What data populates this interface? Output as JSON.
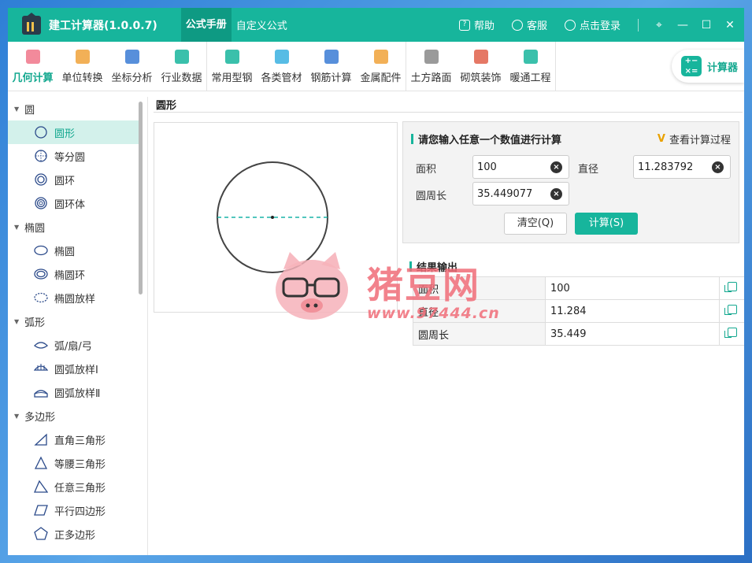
{
  "titlebar": {
    "app_title": "建工计算器(1.0.0.7)",
    "tab_main": "公式手册",
    "tab_custom": "自定义公式",
    "help": "帮助",
    "service": "客服",
    "login": "点击登录",
    "pin": "⌖",
    "minimize": "—",
    "maximize": "☐",
    "close": "✕"
  },
  "toolbar": {
    "groups": [
      [
        {
          "label": "几何计算",
          "icon": "cube-icon",
          "color": "#f0768a",
          "active": true
        },
        {
          "label": "单位转换",
          "icon": "ruler-cm-icon",
          "color": "#f0a23a"
        },
        {
          "label": "坐标分析",
          "icon": "axis-icon",
          "color": "#3a7bd5"
        },
        {
          "label": "行业数据",
          "icon": "bar-chart-icon",
          "color": "#17b59c"
        }
      ],
      [
        {
          "label": "常用型钢",
          "icon": "wrench-icon",
          "color": "#17b59c"
        },
        {
          "label": "各类管材",
          "icon": "pipe-icon",
          "color": "#3ab0e0"
        },
        {
          "label": "钢筋计算",
          "icon": "rebar-icon",
          "color": "#3a7bd5"
        },
        {
          "label": "金属配件",
          "icon": "hammer-icon",
          "color": "#f0a23a"
        }
      ],
      [
        {
          "label": "土方路面",
          "icon": "road-icon",
          "color": "#888888"
        },
        {
          "label": "砌筑装饰",
          "icon": "brick-icon",
          "color": "#e0604a"
        },
        {
          "label": "暖通工程",
          "icon": "fan-icon",
          "color": "#17b59c"
        }
      ]
    ],
    "calc_button": "计算器",
    "calc_icon_glyph": "+−\n×="
  },
  "sidebar": {
    "groups": [
      {
        "title": "圆",
        "items": [
          {
            "label": "圆形",
            "icon": "circle-icon",
            "selected": true
          },
          {
            "label": "等分圆",
            "icon": "divided-circle-icon"
          },
          {
            "label": "圆环",
            "icon": "ring-icon"
          },
          {
            "label": "圆环体",
            "icon": "torus-icon"
          }
        ]
      },
      {
        "title": "椭圆",
        "items": [
          {
            "label": "椭圆",
            "icon": "ellipse-icon"
          },
          {
            "label": "椭圆环",
            "icon": "ellipse-ring-icon"
          },
          {
            "label": "椭圆放样",
            "icon": "ellipse-loft-icon"
          }
        ]
      },
      {
        "title": "弧形",
        "items": [
          {
            "label": "弧/扇/弓",
            "icon": "arc-icon"
          },
          {
            "label": "圆弧放样Ⅰ",
            "icon": "arc-loft-1-icon"
          },
          {
            "label": "圆弧放样Ⅱ",
            "icon": "arc-loft-2-icon"
          }
        ]
      },
      {
        "title": "多边形",
        "items": [
          {
            "label": "直角三角形",
            "icon": "right-triangle-icon"
          },
          {
            "label": "等腰三角形",
            "icon": "isosceles-triangle-icon"
          },
          {
            "label": "任意三角形",
            "icon": "triangle-icon"
          },
          {
            "label": "平行四边形",
            "icon": "parallelogram-icon"
          },
          {
            "label": "正多边形",
            "icon": "pentagon-icon"
          }
        ]
      }
    ]
  },
  "main": {
    "title": "圆形",
    "input_panel": {
      "title": "请您输入任意一个数值进行计算",
      "view_process": "查看计算过程",
      "view_process_glyph": "V",
      "area_label": "面积",
      "area_value": "100",
      "diameter_label": "直径",
      "diameter_value": "11.283792",
      "circumference_label": "圆周长",
      "circumference_value": "35.449077",
      "clear_button": "清空(Q)",
      "calc_button": "计算(S)"
    },
    "result": {
      "title": "结果输出",
      "rows": [
        {
          "key": "面积",
          "value": "100"
        },
        {
          "key": "直径",
          "value": "11.284"
        },
        {
          "key": "圆周长",
          "value": "35.449"
        }
      ]
    }
  },
  "watermark": {
    "text": "猪豆网",
    "url": "www.97444.cn"
  }
}
